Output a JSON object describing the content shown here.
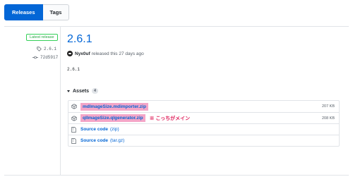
{
  "tabs": [
    {
      "label": "Releases",
      "active": true
    },
    {
      "label": "Tags",
      "active": false
    }
  ],
  "sidebar": {
    "badge": "Latest release",
    "tag": "2.6.1",
    "commit": "72d5917"
  },
  "release": {
    "title": "2.6.1",
    "author": "Nyx0uf",
    "released_text": "released this 27 days ago",
    "body": "2.6.1"
  },
  "assets": {
    "label": "Assets",
    "count": "4",
    "items": [
      {
        "name": "mdImageSize.mdimporter.zip",
        "type": "",
        "size": "207 KB",
        "icon": "package-icon",
        "highlight": true
      },
      {
        "name": "qlImageSize.qlgenerator.zip",
        "type": "",
        "size": "208 KB",
        "icon": "package-icon",
        "highlight": true
      },
      {
        "name": "Source code",
        "type": "(zip)",
        "size": "",
        "icon": "file-zip-icon",
        "highlight": false
      },
      {
        "name": "Source code",
        "type": "(tar.gz)",
        "size": "",
        "icon": "file-zip-icon",
        "highlight": false
      }
    ],
    "annotation": "※ こっちがメイン"
  },
  "colors": {
    "accent": "#0366d6",
    "highlight": "#f4a6c8",
    "annotation": "#e0245e",
    "latest": "#28a745"
  }
}
